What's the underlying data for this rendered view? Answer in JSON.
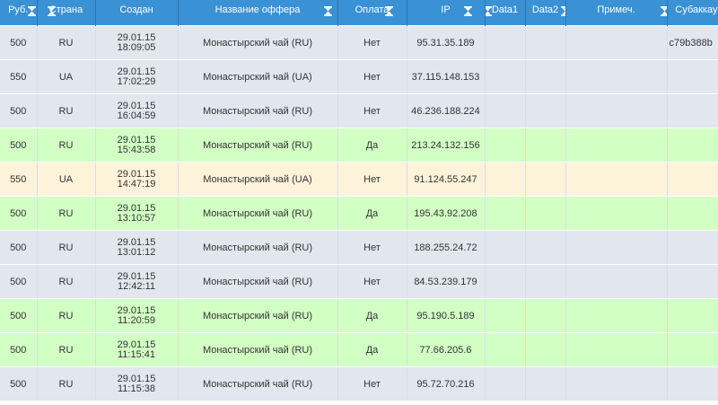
{
  "columns": [
    {
      "id": "rub",
      "label": "Руб.",
      "sortable": true
    },
    {
      "id": "country",
      "label": "Страна",
      "sortable": true
    },
    {
      "id": "created",
      "label": "Создан",
      "sortable": true
    },
    {
      "id": "offer",
      "label": "Название оффера",
      "sortable": true
    },
    {
      "id": "paid",
      "label": "Оплата",
      "sortable": true
    },
    {
      "id": "ip",
      "label": "IP",
      "sortable": true
    },
    {
      "id": "data1",
      "label": "Data1",
      "sortable": true
    },
    {
      "id": "data2",
      "label": "Data2",
      "sortable": true
    },
    {
      "id": "note",
      "label": "Примеч.",
      "sortable": true
    },
    {
      "id": "subaccount",
      "label": "Субаккаунт",
      "sortable": false
    }
  ],
  "rows": [
    {
      "status": "blue",
      "rub": "500",
      "country": "RU",
      "date": "29.01.15",
      "time": "18:09:05",
      "offer": "Монастырский чай (RU)",
      "paid": "Нет",
      "ip": "95.31.35.189",
      "data1": "",
      "data2": "",
      "note": "",
      "subaccount": "c79b388b"
    },
    {
      "status": "blue",
      "rub": "550",
      "country": "UA",
      "date": "29.01.15",
      "time": "17:02:29",
      "offer": "Монастырский чай (UA)",
      "paid": "Нет",
      "ip": "37.115.148.153",
      "data1": "",
      "data2": "",
      "note": "",
      "subaccount": ""
    },
    {
      "status": "blue",
      "rub": "500",
      "country": "RU",
      "date": "29.01.15",
      "time": "16:04:59",
      "offer": "Монастырский чай (RU)",
      "paid": "Нет",
      "ip": "46.236.188.224",
      "data1": "",
      "data2": "",
      "note": "",
      "subaccount": ""
    },
    {
      "status": "green",
      "rub": "500",
      "country": "RU",
      "date": "29.01.15",
      "time": "15:43:58",
      "offer": "Монастырский чай (RU)",
      "paid": "Да",
      "ip": "213.24.132.156",
      "data1": "",
      "data2": "",
      "note": "",
      "subaccount": ""
    },
    {
      "status": "yellow",
      "rub": "550",
      "country": "UA",
      "date": "29.01.15",
      "time": "14:47:19",
      "offer": "Монастырский чай (UA)",
      "paid": "Нет",
      "ip": "91.124.55.247",
      "data1": "",
      "data2": "",
      "note": "",
      "subaccount": ""
    },
    {
      "status": "green",
      "rub": "500",
      "country": "RU",
      "date": "29.01.15",
      "time": "13:10:57",
      "offer": "Монастырский чай (RU)",
      "paid": "Да",
      "ip": "195.43.92.208",
      "data1": "",
      "data2": "",
      "note": "",
      "subaccount": ""
    },
    {
      "status": "blue",
      "rub": "500",
      "country": "RU",
      "date": "29.01.15",
      "time": "13:01:12",
      "offer": "Монастырский чай (RU)",
      "paid": "Нет",
      "ip": "188.255.24.72",
      "data1": "",
      "data2": "",
      "note": "",
      "subaccount": ""
    },
    {
      "status": "blue",
      "rub": "500",
      "country": "RU",
      "date": "29.01.15",
      "time": "12:42:11",
      "offer": "Монастырский чай (RU)",
      "paid": "Нет",
      "ip": "84.53.239.179",
      "data1": "",
      "data2": "",
      "note": "",
      "subaccount": ""
    },
    {
      "status": "green",
      "rub": "500",
      "country": "RU",
      "date": "29.01.15",
      "time": "11:20:59",
      "offer": "Монастырский чай (RU)",
      "paid": "Да",
      "ip": "95.190.5.189",
      "data1": "",
      "data2": "",
      "note": "",
      "subaccount": ""
    },
    {
      "status": "green",
      "rub": "500",
      "country": "RU",
      "date": "29.01.15",
      "time": "11:15:41",
      "offer": "Монастырский чай (RU)",
      "paid": "Да",
      "ip": "77.66.205.6",
      "data1": "",
      "data2": "",
      "note": "",
      "subaccount": ""
    },
    {
      "status": "blue",
      "rub": "500",
      "country": "RU",
      "date": "29.01.15",
      "time": "11:15:38",
      "offer": "Монастырский чай (RU)",
      "paid": "Нет",
      "ip": "95.72.70.216",
      "data1": "",
      "data2": "",
      "note": "",
      "subaccount": ""
    }
  ],
  "colors": {
    "header": "#3a91d4",
    "row_unpaid": "#e2e6ef",
    "row_paid": "#d2ffc4",
    "row_pending": "#fdf3da"
  },
  "icons": {
    "sort": "sort-hourglass-icon"
  }
}
